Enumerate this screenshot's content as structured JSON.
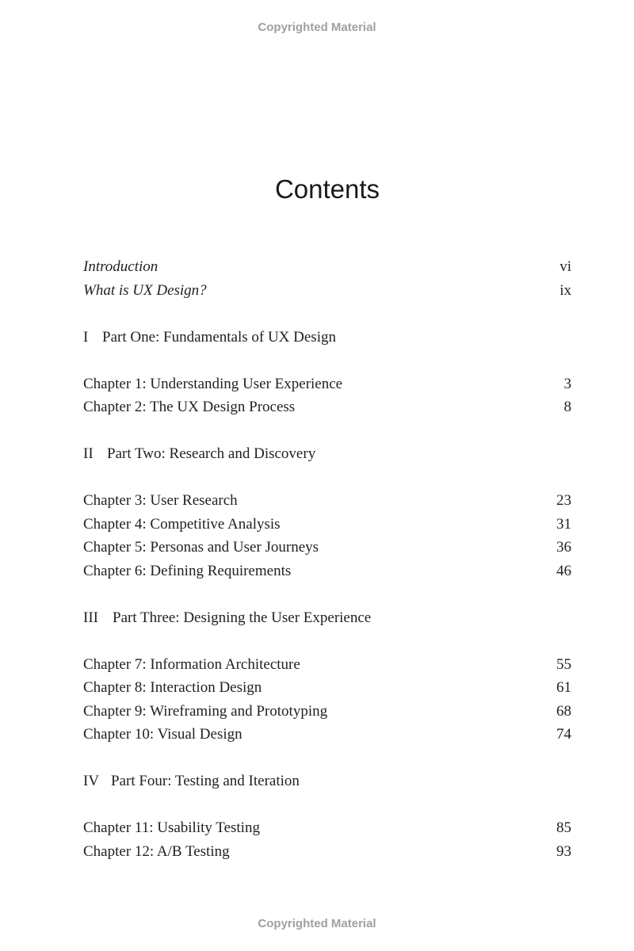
{
  "watermark": "Copyrighted Material",
  "title": "Contents",
  "front_matter": [
    {
      "label": "Introduction",
      "page": "vi"
    },
    {
      "label": "What is UX Design?",
      "page": "ix"
    }
  ],
  "parts": [
    {
      "numeral": "I",
      "title": "Part One: Fundamentals of UX Design",
      "chapters": [
        {
          "label": "Chapter 1: Understanding User Experience",
          "page": "3"
        },
        {
          "label": "Chapter 2: The UX Design Process",
          "page": "8"
        }
      ]
    },
    {
      "numeral": "II",
      "title": "Part Two: Research and Discovery",
      "chapters": [
        {
          "label": "Chapter 3: User Research",
          "page": "23"
        },
        {
          "label": "Chapter 4: Competitive Analysis",
          "page": "31"
        },
        {
          "label": "Chapter 5: Personas and User Journeys",
          "page": "36"
        },
        {
          "label": "Chapter 6: Defining Requirements",
          "page": "46"
        }
      ]
    },
    {
      "numeral": "III",
      "title": "Part Three: Designing the User Experience",
      "chapters": [
        {
          "label": "Chapter 7: Information Architecture",
          "page": "55"
        },
        {
          "label": "Chapter 8: Interaction Design",
          "page": "61"
        },
        {
          "label": "Chapter 9: Wireframing and Prototyping",
          "page": "68"
        },
        {
          "label": "Chapter 10: Visual Design",
          "page": "74"
        }
      ]
    },
    {
      "numeral": "IV",
      "title": "Part Four: Testing and Iteration",
      "chapters": [
        {
          "label": "Chapter 11: Usability Testing",
          "page": "85"
        },
        {
          "label": "Chapter 12: A/B Testing",
          "page": "93"
        }
      ]
    }
  ]
}
